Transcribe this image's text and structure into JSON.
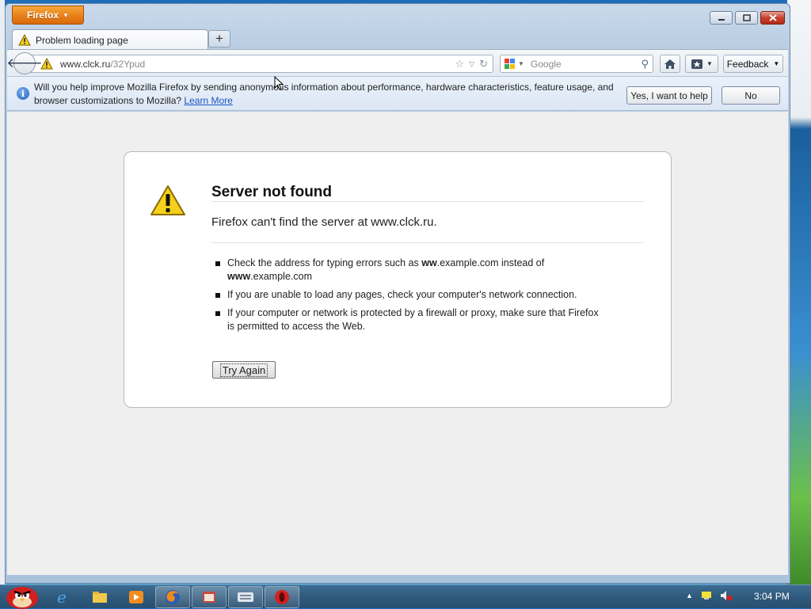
{
  "app": {
    "menu_label": "Firefox"
  },
  "tab": {
    "title": "Problem loading page",
    "new_tab": "+"
  },
  "navbar": {
    "url_host": "www.clck.ru",
    "url_path": "/32Ypud",
    "search_placeholder": "Google",
    "feedback_label": "Feedback"
  },
  "notification": {
    "message": "Will you help improve Mozilla Firefox by sending anonymous information about performance, hardware characteristics, feature usage, and browser customizations to Mozilla?",
    "learn_more": "Learn More",
    "yes_label": "Yes, I want to help",
    "no_label": "No"
  },
  "error": {
    "title": "Server not found",
    "description": "Firefox can't find the server at www.clck.ru.",
    "item1_pre": "Check the address for typing errors such as ",
    "item1_bold1": "ww",
    "item1_mid": ".example.com instead of ",
    "item1_bold2": "www",
    "item1_post": ".example.com",
    "item2": "If you are unable to load any pages, check your computer's network connection.",
    "item3": "If your computer or network is protected by a firewall or proxy, make sure that Firefox is permitted to access the Web.",
    "try_again": "Try Again"
  },
  "taskbar": {
    "clock": "3:04 PM"
  },
  "colors": {
    "firefox_orange": "#e8801a",
    "link_blue": "#1a55c4",
    "warning_yellow": "#f5d01c"
  }
}
